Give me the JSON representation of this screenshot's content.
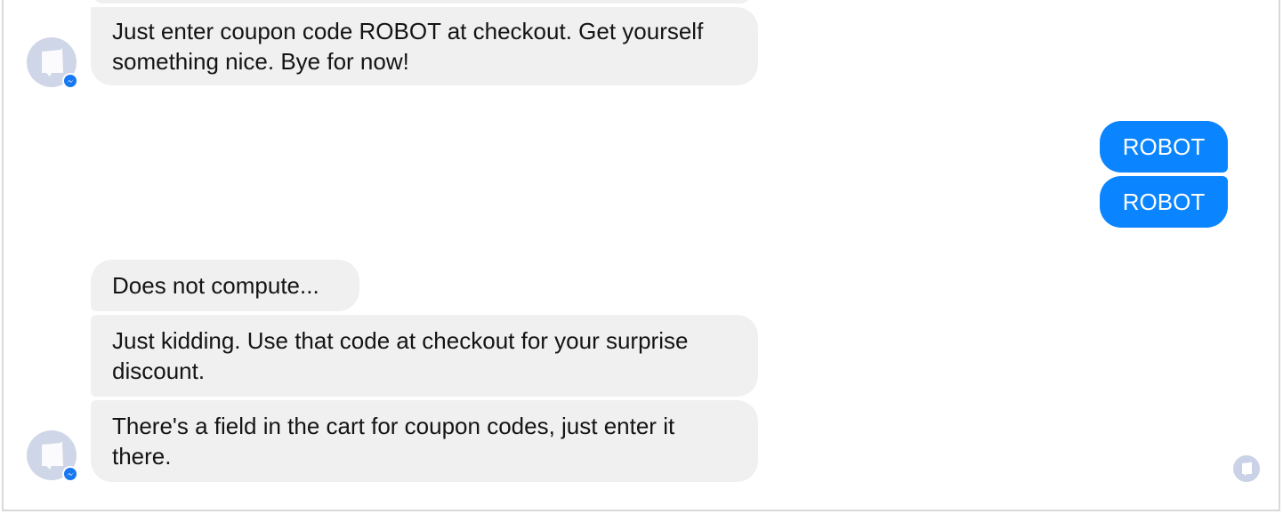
{
  "conversation": {
    "messages": [
      {
        "sender": "bot",
        "text": "Just enter coupon code ROBOT at checkout. Get yourself something nice. Bye for now!"
      },
      {
        "sender": "user",
        "text": "ROBOT"
      },
      {
        "sender": "user",
        "text": "ROBOT"
      },
      {
        "sender": "bot",
        "text": "Does not compute..."
      },
      {
        "sender": "bot",
        "text": "Just kidding. Use that code at checkout for your surprise discount."
      },
      {
        "sender": "bot",
        "text": "There's a field in the cart for coupon codes, just enter it there."
      }
    ]
  },
  "icons": {
    "bot_avatar": "flag-avatar-icon",
    "messenger_badge": "messenger-badge-icon",
    "seen_indicator": "seen-avatar-icon"
  },
  "colors": {
    "bot_bubble": "#f0f0f0",
    "user_bubble": "#0a84ff",
    "avatar": "#cfd6e8",
    "badge": "#1877f2"
  }
}
